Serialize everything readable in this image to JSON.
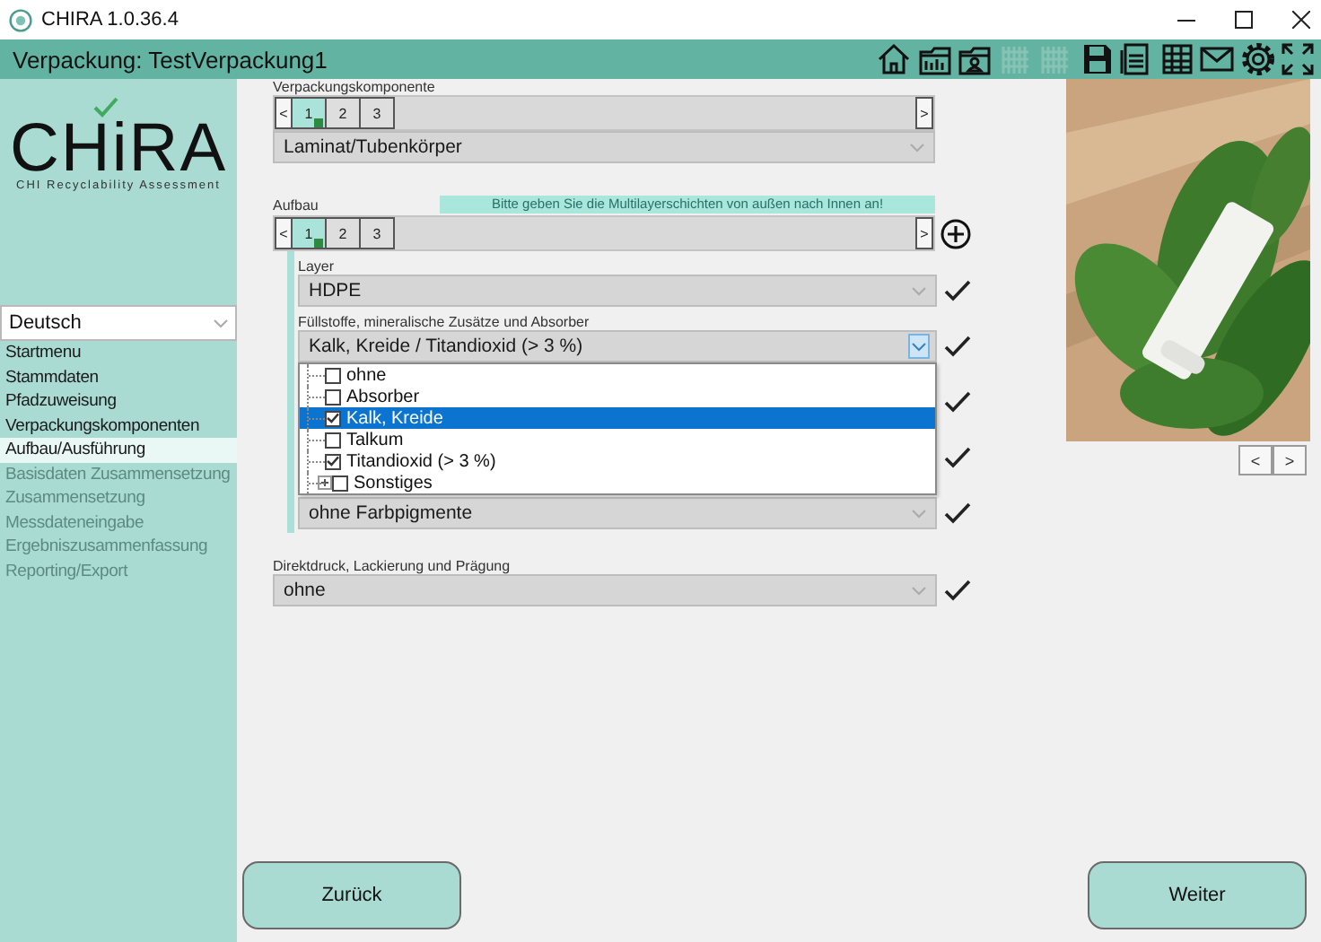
{
  "window": {
    "title": "CHIRA 1.0.36.4"
  },
  "header": {
    "title": "Verpackung: TestVerpackung1",
    "tools": [
      {
        "kind": "home",
        "disabled": false
      },
      {
        "kind": "folder-chart",
        "disabled": false
      },
      {
        "kind": "folder-person",
        "disabled": false
      },
      {
        "kind": "grid",
        "disabled": true
      },
      {
        "kind": "grid",
        "disabled": true
      },
      {
        "kind": "save",
        "disabled": false
      },
      {
        "kind": "document",
        "disabled": false
      },
      {
        "kind": "table",
        "disabled": false
      },
      {
        "kind": "mail",
        "disabled": false
      },
      {
        "kind": "settings",
        "disabled": false
      },
      {
        "kind": "fullscreen",
        "disabled": false
      }
    ]
  },
  "logo": {
    "name": "CHiRA",
    "tagline": "CHI Recyclability Assessment"
  },
  "sidebar": {
    "language": "Deutsch",
    "items": [
      {
        "label": "Startmenu",
        "selected": false,
        "disabled": false
      },
      {
        "label": "Stammdaten",
        "selected": false,
        "disabled": false
      },
      {
        "label": "Pfadzuweisung",
        "selected": false,
        "disabled": false
      },
      {
        "label": "Verpackungskomponenten",
        "selected": false,
        "disabled": false
      },
      {
        "label": "Aufbau/Ausführung",
        "selected": true,
        "disabled": false
      },
      {
        "label": "Basisdaten Zusammensetzung",
        "selected": false,
        "disabled": true
      },
      {
        "label": "Zusammensetzung",
        "selected": false,
        "disabled": true
      },
      {
        "label": "Messdateneingabe",
        "selected": false,
        "disabled": true
      },
      {
        "label": "Ergebniszusammenfassung",
        "selected": false,
        "disabled": true
      },
      {
        "label": "Reporting/Export",
        "selected": false,
        "disabled": true
      }
    ]
  },
  "component": {
    "label": "Verpackungskomponente",
    "prev": "<",
    "next": ">",
    "tabs": [
      {
        "label": "1",
        "selected": true
      },
      {
        "label": "2",
        "selected": false
      },
      {
        "label": "3",
        "selected": false
      }
    ],
    "value": "Laminat/Tubenkörper"
  },
  "structure": {
    "label": "Aufbau",
    "hint": "Bitte geben Sie die Multilayerschichten von außen nach Innen an!",
    "prev": "<",
    "next": ">",
    "tabs": [
      {
        "label": "1",
        "selected": true
      },
      {
        "label": "2",
        "selected": false
      },
      {
        "label": "3",
        "selected": false
      }
    ],
    "layers": [
      {
        "kind": "select",
        "label": "Layer",
        "value": "HDPE",
        "valid": true
      },
      {
        "kind": "multiselect",
        "label": "Füllstoffe, mineralische Zusätze und Absorber",
        "value": "Kalk, Kreide / Titandioxid (> 3 %)",
        "valid": true,
        "expanded": true,
        "options": [
          {
            "label": "ohne",
            "checked": false,
            "selected": false,
            "expandable": false
          },
          {
            "label": "Absorber",
            "checked": false,
            "selected": false,
            "expandable": false
          },
          {
            "label": "Kalk, Kreide",
            "checked": true,
            "selected": true,
            "expandable": false
          },
          {
            "label": "Talkum",
            "checked": false,
            "selected": false,
            "expandable": false
          },
          {
            "label": "Titandioxid (> 3 %)",
            "checked": true,
            "selected": false,
            "expandable": false
          },
          {
            "label": "Sonstiges",
            "checked": false,
            "selected": false,
            "expandable": true
          }
        ]
      },
      {
        "kind": "covered",
        "valid": true
      },
      {
        "kind": "covered",
        "valid": true
      },
      {
        "kind": "select",
        "value": "ohne Farbpigmente",
        "valid": true
      }
    ]
  },
  "print": {
    "label": "Direktdruck, Lackierung und Prägung",
    "value": "ohne",
    "valid": true
  },
  "gallery": {
    "prev": "<",
    "next": ">"
  },
  "buttons": {
    "back": "Zurück",
    "next": "Weiter"
  }
}
